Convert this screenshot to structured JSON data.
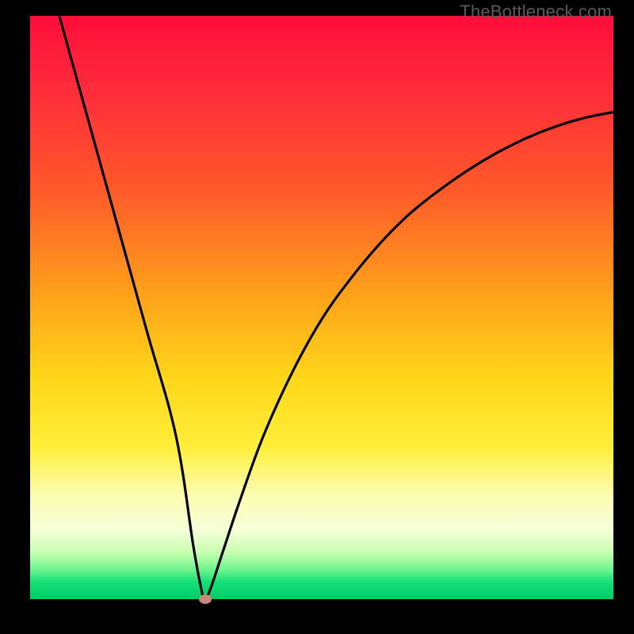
{
  "watermark": "TheBottleneck.com",
  "colors": {
    "frame": "#000000",
    "curve": "#000000",
    "marker": "#cc8877",
    "gradient_stops": [
      "#ff0d3a",
      "#ff2a3a",
      "#ff5a2a",
      "#ffa21a",
      "#ffd61a",
      "#ffef3a",
      "#fcfcb0",
      "#f8ffd8",
      "#c6ffb0",
      "#6cf48e",
      "#18e07a",
      "#00cc66"
    ]
  },
  "chart_data": {
    "type": "line",
    "title": "",
    "xlabel": "",
    "ylabel": "",
    "xlim": [
      0,
      100
    ],
    "ylim": [
      0,
      100
    ],
    "grid": false,
    "legend": false,
    "series": [
      {
        "name": "bottleneck-curve",
        "x": [
          5,
          10,
          15,
          20,
          25,
          28,
          29.5,
          30,
          31,
          33,
          36,
          40,
          45,
          50,
          55,
          60,
          65,
          70,
          75,
          80,
          85,
          90,
          95,
          100
        ],
        "values": [
          100,
          82,
          64,
          46,
          28,
          9,
          1,
          0,
          2,
          8,
          17,
          28,
          39,
          48,
          55,
          61,
          66,
          70,
          73.5,
          76.5,
          79,
          81,
          82.5,
          83.5
        ]
      }
    ],
    "marker": {
      "x": 30,
      "y": 0,
      "name": "selected-point"
    },
    "background_scale": {
      "orientation": "vertical",
      "meaning": "bottleneck severity (red=high, green=low)",
      "stops": [
        {
          "pos": 0,
          "color": "#ff0d3a"
        },
        {
          "pos": 50,
          "color": "#ffd61a"
        },
        {
          "pos": 88,
          "color": "#f8ffd8"
        },
        {
          "pos": 100,
          "color": "#00cc66"
        }
      ]
    }
  }
}
